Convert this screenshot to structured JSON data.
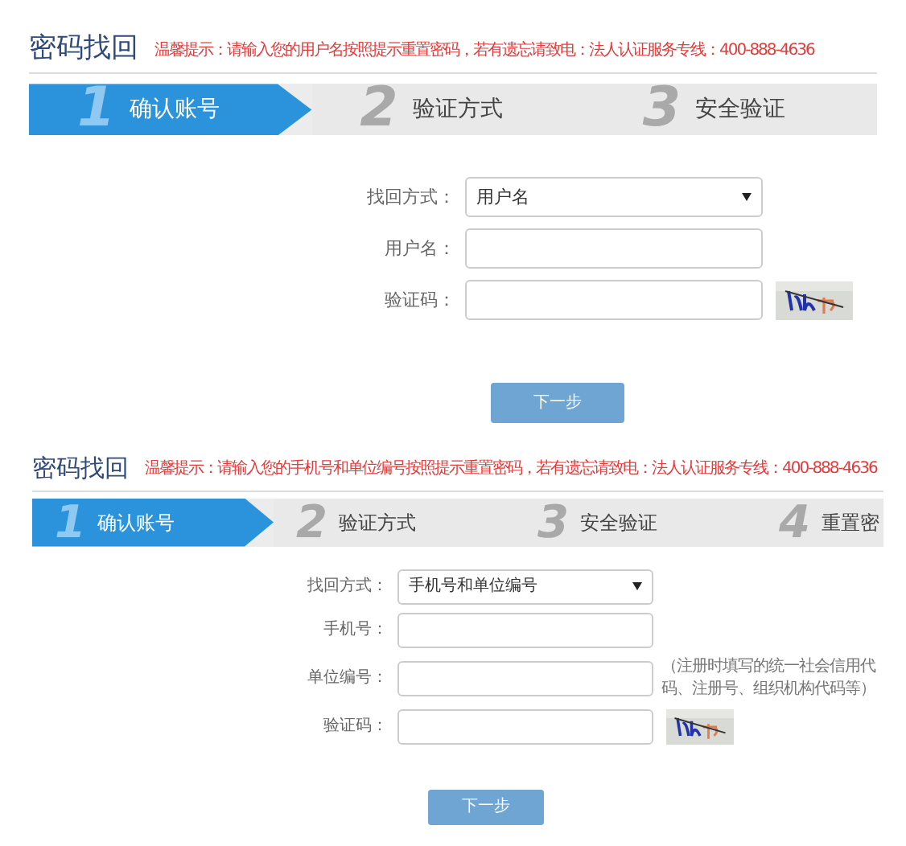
{
  "panels": [
    {
      "title": "密码找回",
      "notice": "温馨提示：请输入您的用户名按照提示重置密码，若有遗忘请致电：法人认证服务专线：400-888-4636",
      "steps": [
        {
          "number": "1",
          "label": "确认账号",
          "selected": true
        },
        {
          "number": "2",
          "label": "验证方式",
          "selected": false
        },
        {
          "number": "3",
          "label": "安全验证",
          "selected": false
        }
      ],
      "fields": [
        {
          "kind": "select",
          "label": "找回方式：",
          "value": "用户名"
        },
        {
          "kind": "input",
          "label": "用户名："
        },
        {
          "kind": "captcha",
          "label": "验证码："
        }
      ],
      "button": "下一步"
    },
    {
      "title": "密码找回",
      "notice": "温馨提示：请输入您的手机号和单位编号按照提示重置密码，若有遗忘请致电：法人认证服务专线：400-888-4636",
      "steps": [
        {
          "number": "1",
          "label": "确认账号",
          "selected": true
        },
        {
          "number": "2",
          "label": "验证方式",
          "selected": false
        },
        {
          "number": "3",
          "label": "安全验证",
          "selected": false
        },
        {
          "number": "4",
          "label": "重置密",
          "selected": false
        }
      ],
      "fields": [
        {
          "kind": "select",
          "label": "找回方式：",
          "value": "手机号和单位编号"
        },
        {
          "kind": "input",
          "label": "手机号："
        },
        {
          "kind": "input",
          "label": "单位编号：",
          "note": "（注册时填写的统一社会信用代码、注册号、组织机构代码等）"
        },
        {
          "kind": "captcha",
          "label": "验证码："
        }
      ],
      "button": "下一步"
    }
  ]
}
